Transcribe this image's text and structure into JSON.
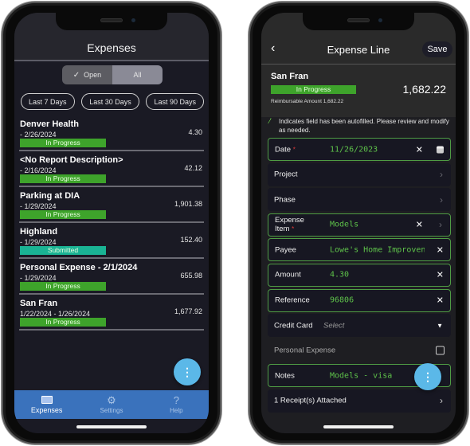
{
  "left": {
    "header": {
      "title": "Expenses"
    },
    "filter_toggle": {
      "options": [
        "Open",
        "All"
      ],
      "selected": "Open"
    },
    "date_chips": [
      "Last 7 Days",
      "Last 30 Days",
      "Last 90 Days"
    ],
    "reports": [
      {
        "name": "Denver Health",
        "date": " - 2/26/2024",
        "amount": "4.30",
        "status": "In Progress"
      },
      {
        "name": "<No Report Description>",
        "date": " - 2/16/2024",
        "amount": "42.12",
        "status": "In Progress"
      },
      {
        "name": "Parking at DIA",
        "date": " - 1/29/2024",
        "amount": "1,901.38",
        "status": "In Progress"
      },
      {
        "name": "Highland",
        "date": " - 1/29/2024",
        "amount": "152.40",
        "status": "Submitted"
      },
      {
        "name": "Personal Expense - 2/1/2024",
        "date": " - 1/29/2024",
        "amount": "655.98",
        "status": "In Progress"
      },
      {
        "name": "San Fran",
        "date": "1/22/2024 - 1/26/2024",
        "amount": "1,677.92",
        "status": "In Progress"
      }
    ],
    "fab_icon": "more-vertical-icon",
    "tabs": [
      {
        "label": "Expenses",
        "icon": "card-icon",
        "active": true
      },
      {
        "label": "Settings",
        "icon": "gear-icon",
        "active": false
      },
      {
        "label": "Help",
        "icon": "question-icon",
        "active": false
      }
    ]
  },
  "right": {
    "header": {
      "title": "Expense Line",
      "back_icon": "chevron-left-icon",
      "save_label": "Save"
    },
    "summary": {
      "name": "San Fran",
      "status": "In Progress",
      "total": "1,682.22",
      "reimbursable": "Reimbursable Amount 1,682.22"
    },
    "autofill_note": "Indicates field has been autofilled. Please review and modify as needed.",
    "fields": {
      "date": {
        "label": "Date",
        "value": "11/26/2023"
      },
      "project": {
        "label": "Project"
      },
      "phase": {
        "label": "Phase"
      },
      "expense_item": {
        "label_line1": "Expense",
        "label_line2": "Item",
        "value": "Models"
      },
      "payee": {
        "label": "Payee",
        "value": "Lowe's Home Improven"
      },
      "amount": {
        "label": "Amount",
        "value": "4.30"
      },
      "reference": {
        "label": "Reference",
        "value": "96806"
      },
      "credit_card": {
        "label": "Credit Card",
        "placeholder": "Select"
      },
      "personal_expense": {
        "label": "Personal Expense",
        "checked": false
      },
      "notes": {
        "label": "Notes",
        "value": "Models - visa"
      },
      "receipts": {
        "label": "1 Receipt(s) Attached"
      }
    },
    "required_mark": "*"
  },
  "colors": {
    "in_progress": "#3ea32b",
    "submitted": "#1ab394",
    "autofill_green": "#5ec24a",
    "tabbar_blue": "#3a72bc",
    "fab_blue": "#5bb8e8",
    "required_red": "#e23a3a"
  }
}
